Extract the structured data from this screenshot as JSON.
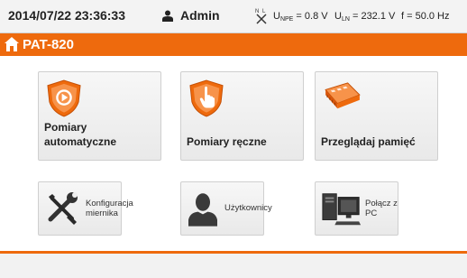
{
  "status_bar": {
    "datetime": "2014/07/22 23:36:33",
    "user": "Admin",
    "u_npe_label": "U",
    "u_npe_sub": "NPE",
    "u_npe_value": "= 0.8 V",
    "u_ln_label": "U",
    "u_ln_sub": "LN",
    "u_ln_value": "= 232.1 V",
    "frequency": "f = 50.0 Hz"
  },
  "title_bar": {
    "title": "PAT-820"
  },
  "main_tiles": [
    {
      "label": "Pomiary automatyczne",
      "icon": "auto-measurement-shield-icon"
    },
    {
      "label": "Pomiary ręczne",
      "icon": "manual-measurement-shield-icon"
    },
    {
      "label": "Przeglądaj pamięć",
      "icon": "memory-icon"
    }
  ],
  "tool_tiles": [
    {
      "label": "Konfiguracja miernika",
      "icon": "tools-icon"
    },
    {
      "label": "Użytkownicy",
      "icon": "user-silhouette-icon"
    },
    {
      "label": "Połącz z PC",
      "icon": "computer-icon"
    }
  ],
  "colors": {
    "accent": "#ee6a0d",
    "tile_bg": "#eeeeee",
    "status_bg": "#f3f3f3"
  }
}
